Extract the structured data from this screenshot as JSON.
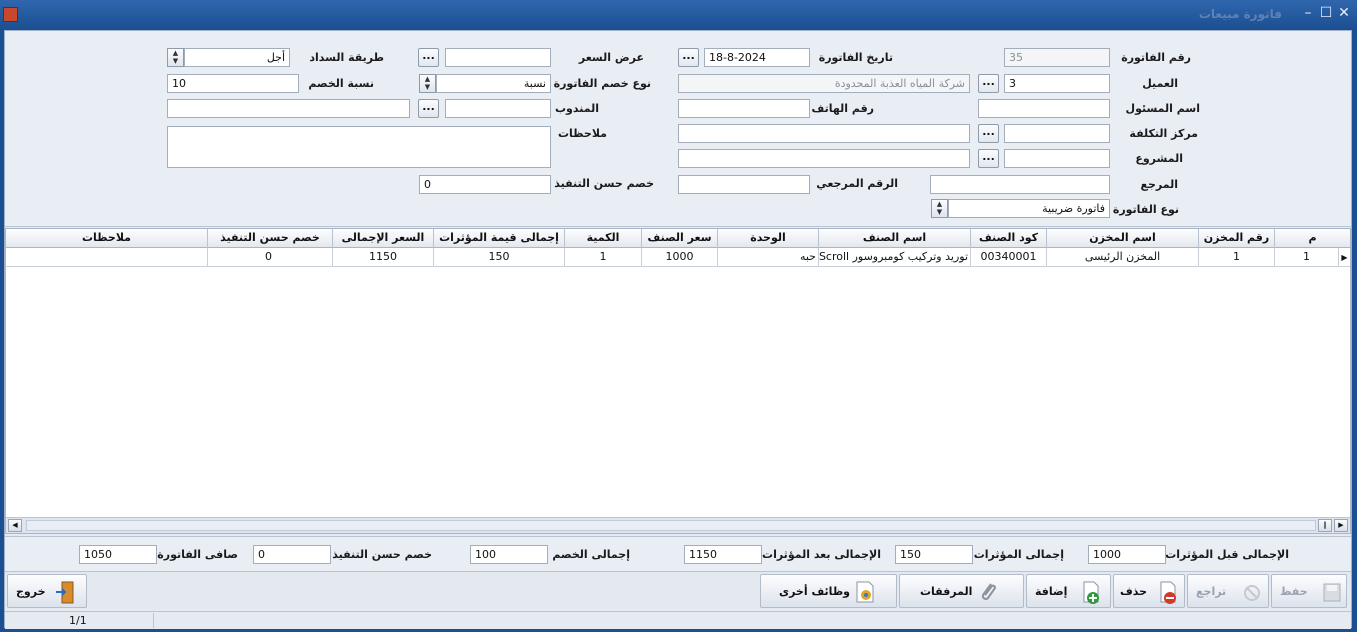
{
  "window": {
    "title": "فاتورة مبيعات"
  },
  "form": {
    "invoice_no_label": "رقم الفاتورة",
    "invoice_no": "35",
    "invoice_date_label": "تاريخ الفاتورة",
    "invoice_date": "18-8-2024",
    "quote_label": "عرض السعر",
    "quote": "",
    "payment_label": "طريقة السداد",
    "payment": "أجل",
    "customer_label": "العميل",
    "customer_code": "3",
    "customer_name": "شركة المياه العذبة المحدودة",
    "discount_type_label": "نوع خصم الفاتورة",
    "discount_type": "نسبة",
    "discount_rate_label": "نسبة الخصم",
    "discount_rate": "10",
    "responsible_label": "اسم المسئول",
    "responsible": "",
    "phone_label": "رقم الهاتف",
    "phone": "",
    "rep_label": "المندوب",
    "rep_code": "",
    "rep_name": "",
    "cost_center_label": "مركز التكلفة",
    "cost_center_code": "",
    "cost_center_name": "",
    "notes_label": "ملاحظات",
    "notes": "",
    "project_label": "المشروع",
    "project_code": "",
    "project_name": "",
    "reference_label": "المرجع",
    "reference": "",
    "ref_no_label": "الرقم المرجعي",
    "ref_no": "",
    "good_exec_label": "خصم حسن التنفيذ",
    "good_exec": "0",
    "invoice_type_label": "نوع الفاتورة",
    "invoice_type": "فاتورة ضريبية",
    "dots": "..."
  },
  "grid": {
    "headers": {
      "m": "م",
      "store_no": "رقم المخزن",
      "store_name": "اسم المخزن",
      "item_code": "كود الصنف",
      "item_name": "اسم الصنف",
      "unit": "الوحدة",
      "price": "سعر الصنف",
      "qty": "الكمية",
      "effects_total": "إجمالى قيمة المؤثرات",
      "total_price": "السعر الإجمالى",
      "good_exec": "خصم حسن التنفيذ",
      "notes": "ملاحظات"
    },
    "rows": [
      {
        "m": "1",
        "store_no": "1",
        "store_name": "المخزن الرئيسى",
        "item_code": "00340001",
        "item_name": "توريد وتركيب كومبروسور Scroll م",
        "unit": "حبه",
        "price": "1000",
        "qty": "1",
        "effects_total": "150",
        "total_price": "1150",
        "good_exec": "0",
        "notes": ""
      }
    ]
  },
  "totals": {
    "before_effects_label": "الإجمالى قبل المؤثرات",
    "before_effects": "1000",
    "effects_label": "إجمالى المؤثرات",
    "effects": "150",
    "after_effects_label": "الإجمالى بعد المؤثرات",
    "after_effects": "1150",
    "discount_total_label": "إجمالى الخصم",
    "discount_total": "100",
    "good_exec_label": "خصم حسن التنفيذ",
    "good_exec": "0",
    "net_label": "صافى الفاتورة",
    "net": "1050"
  },
  "toolbar": {
    "save": "حفظ",
    "undo": "تراجع",
    "delete": "حذف",
    "add": "إضافة",
    "attachments": "المرفقات",
    "other": "وظائف أخرى",
    "exit": "خروج"
  },
  "status": {
    "record": "1/1"
  }
}
